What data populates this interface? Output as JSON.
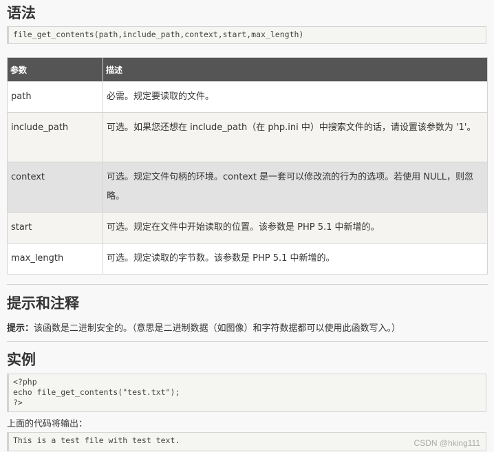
{
  "syntax": {
    "heading": "语法",
    "code": "file_get_contents(path,include_path,context,start,max_length)"
  },
  "params_table": {
    "headers": [
      "参数",
      "描述"
    ],
    "rows": [
      {
        "param": "path",
        "desc": "必需。规定要读取的文件。"
      },
      {
        "param": "include_path",
        "desc": "可选。如果您还想在 include_path（在 php.ini 中）中搜索文件的话，请设置该参数为 '1'。"
      },
      {
        "param": "context",
        "desc": "可选。规定文件句柄的环境。context 是一套可以修改流的行为的选项。若使用 NULL，则忽略。"
      },
      {
        "param": "start",
        "desc": "可选。规定在文件中开始读取的位置。该参数是 PHP 5.1 中新增的。"
      },
      {
        "param": "max_length",
        "desc": "可选。规定读取的字节数。该参数是 PHP 5.1 中新增的。"
      }
    ]
  },
  "tips": {
    "heading": "提示和注释",
    "label": "提示：",
    "text": "该函数是二进制安全的。（意思是二进制数据（如图像）和字符数据都可以使用此函数写入。）"
  },
  "example": {
    "heading": "实例",
    "code": "<?php\necho file_get_contents(\"test.txt\");\n?>",
    "output_label": "上面的代码将输出：",
    "output": "This is a test file with test text."
  },
  "watermark": "CSDN @hking111"
}
